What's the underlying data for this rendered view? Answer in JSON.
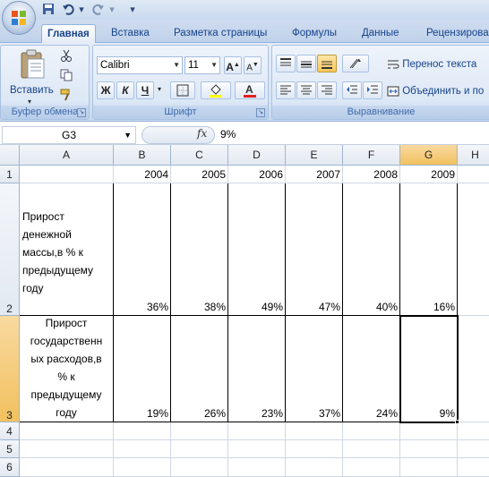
{
  "quick_access": {
    "save_icon": "save-icon",
    "undo_icon": "undo-icon",
    "redo_icon": "redo-icon"
  },
  "tabs": [
    {
      "label": "Главная",
      "active": true
    },
    {
      "label": "Вставка"
    },
    {
      "label": "Разметка страницы"
    },
    {
      "label": "Формулы"
    },
    {
      "label": "Данные"
    },
    {
      "label": "Рецензирова"
    }
  ],
  "ribbon": {
    "clipboard": {
      "paste_label": "Вставить",
      "group_label": "Буфер обмена"
    },
    "font": {
      "name": "Calibri",
      "size": "11",
      "bold": "Ж",
      "italic": "К",
      "underline": "Ч",
      "group_label": "Шрифт"
    },
    "alignment": {
      "wrap_text": "Перенос текста",
      "merge": "Объединить и по",
      "group_label": "Выравнивание"
    }
  },
  "formula_bar": {
    "name_box": "G3",
    "fx": "fx",
    "value": "9%"
  },
  "columns": [
    "A",
    "B",
    "C",
    "D",
    "E",
    "F",
    "G",
    "H"
  ],
  "rows": [
    "1",
    "2",
    "3",
    "4",
    "5",
    "6"
  ],
  "sheet": {
    "row1": [
      "",
      "2004",
      "2005",
      "2006",
      "2007",
      "2008",
      "2009"
    ],
    "row2_label_lines": [
      "Прирост",
      "денежной",
      "массы,в % к",
      "предыдущему",
      "году"
    ],
    "row2": [
      "36%",
      "38%",
      "49%",
      "47%",
      "40%",
      "16%"
    ],
    "row3_label_lines": [
      "Прирост",
      "государственн",
      "ых расходов,в",
      "% к",
      "предыдущему",
      "году"
    ],
    "row3": [
      "19%",
      "26%",
      "23%",
      "37%",
      "24%",
      "9%"
    ]
  },
  "selected_cell": "G3",
  "colors": {
    "accent": "#15428b",
    "selection_header": "#f1c15f",
    "grid_line": "#d0d7e5"
  }
}
